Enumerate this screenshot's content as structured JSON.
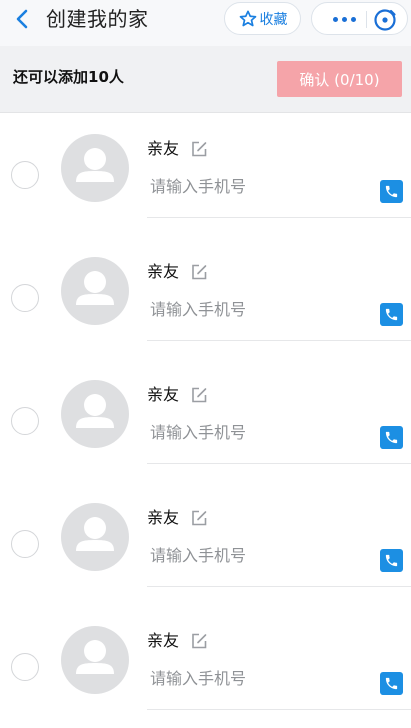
{
  "header": {
    "title": "创建我的家",
    "favorite_label": "收藏"
  },
  "subheader": {
    "limit_text": "还可以添加10人",
    "confirm_label": "确认 (0/10)"
  },
  "members": [
    {
      "name": "亲友",
      "phone_placeholder": "请输入手机号"
    },
    {
      "name": "亲友",
      "phone_placeholder": "请输入手机号"
    },
    {
      "name": "亲友",
      "phone_placeholder": "请输入手机号"
    },
    {
      "name": "亲友",
      "phone_placeholder": "请输入手机号"
    },
    {
      "name": "亲友",
      "phone_placeholder": "请输入手机号"
    }
  ],
  "icons": {
    "back": "chevron-left-icon",
    "favorite": "star-icon",
    "more": "more-dots-icon",
    "close": "close-icon",
    "edit": "edit-icon",
    "phone": "phone-icon",
    "avatar": "user-avatar-icon"
  },
  "colors": {
    "accent": "#1a7fe0",
    "confirm_disabled": "#f5a4a9",
    "phone_badge": "#1c8fe3"
  }
}
